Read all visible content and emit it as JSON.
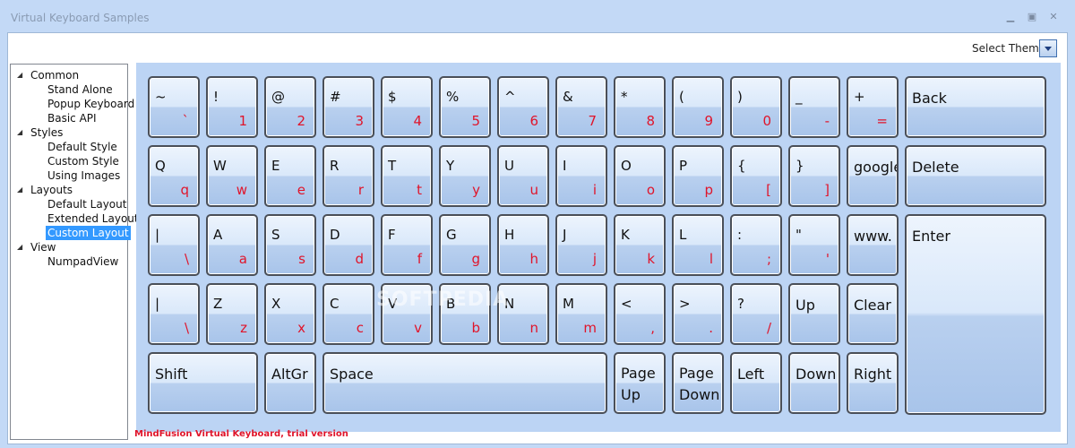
{
  "window": {
    "title": "Virtual Keyboard Samples",
    "minimize_icon": "minimize-icon",
    "maximize_icon": "maximize-icon",
    "close_icon": "close-icon"
  },
  "theme": {
    "label": "Select Theme"
  },
  "tree": {
    "groups": [
      {
        "label": "Common",
        "children": [
          "Stand Alone",
          "Popup Keyboard",
          "Basic API"
        ]
      },
      {
        "label": "Styles",
        "children": [
          "Default Style",
          "Custom Style",
          "Using Images"
        ]
      },
      {
        "label": "Layouts",
        "children": [
          "Default Layout",
          "Extended Layout",
          "Custom Layout"
        ]
      },
      {
        "label": "View",
        "children": [
          "NumpadView"
        ]
      }
    ],
    "selected": "Custom Layout"
  },
  "keyboard": {
    "row1": [
      {
        "up": "~",
        "low": "`"
      },
      {
        "up": "!",
        "low": "1"
      },
      {
        "up": "@",
        "low": "2"
      },
      {
        "up": "#",
        "low": "3"
      },
      {
        "up": "$",
        "low": "4"
      },
      {
        "up": "%",
        "low": "5"
      },
      {
        "up": "^",
        "low": "6"
      },
      {
        "up": "&",
        "low": "7"
      },
      {
        "up": "*",
        "low": "8"
      },
      {
        "up": "(",
        "low": "9"
      },
      {
        "up": ")",
        "low": "0"
      },
      {
        "up": "_",
        "low": "-"
      },
      {
        "up": "+",
        "low": "="
      }
    ],
    "row2": [
      {
        "up": "Q",
        "low": "q"
      },
      {
        "up": "W",
        "low": "w"
      },
      {
        "up": "E",
        "low": "e"
      },
      {
        "up": "R",
        "low": "r"
      },
      {
        "up": "T",
        "low": "t"
      },
      {
        "up": "Y",
        "low": "y"
      },
      {
        "up": "U",
        "low": "u"
      },
      {
        "up": "I",
        "low": "i"
      },
      {
        "up": "O",
        "low": "o"
      },
      {
        "up": "P",
        "low": "p"
      },
      {
        "up": "{",
        "low": "["
      },
      {
        "up": "}",
        "low": "]"
      }
    ],
    "row3": [
      {
        "up": "|",
        "low": "\\"
      },
      {
        "up": "A",
        "low": "a"
      },
      {
        "up": "S",
        "low": "s"
      },
      {
        "up": "D",
        "low": "d"
      },
      {
        "up": "F",
        "low": "f"
      },
      {
        "up": "G",
        "low": "g"
      },
      {
        "up": "H",
        "low": "h"
      },
      {
        "up": "J",
        "low": "j"
      },
      {
        "up": "K",
        "low": "k"
      },
      {
        "up": "L",
        "low": "l"
      },
      {
        "up": ":",
        "low": ";"
      },
      {
        "up": "\"",
        "low": "'"
      }
    ],
    "row4": [
      {
        "up": "|",
        "low": "\\"
      },
      {
        "up": "Z",
        "low": "z"
      },
      {
        "up": "X",
        "low": "x"
      },
      {
        "up": "C",
        "low": "c"
      },
      {
        "up": "V",
        "low": "v"
      },
      {
        "up": "B",
        "low": "b"
      },
      {
        "up": "N",
        "low": "n"
      },
      {
        "up": "M",
        "low": "m"
      },
      {
        "up": "<",
        "low": ","
      },
      {
        "up": ">",
        "low": "."
      },
      {
        "up": "?",
        "low": "/"
      }
    ],
    "special": {
      "back": "Back",
      "delete": "Delete",
      "enter": "Enter",
      "google": "google",
      "www": "www.",
      "up": "Up",
      "clear": "Clear",
      "shift": "Shift",
      "altgr": "AltGr",
      "space": "Space",
      "page_up": "Page Up",
      "page_down": "Page Down",
      "left": "Left",
      "down": "Down",
      "right": "Right"
    }
  },
  "footer": {
    "trial": "MindFusion Virtual Keyboard, trial version"
  },
  "watermark": "SOFTPEDIA"
}
